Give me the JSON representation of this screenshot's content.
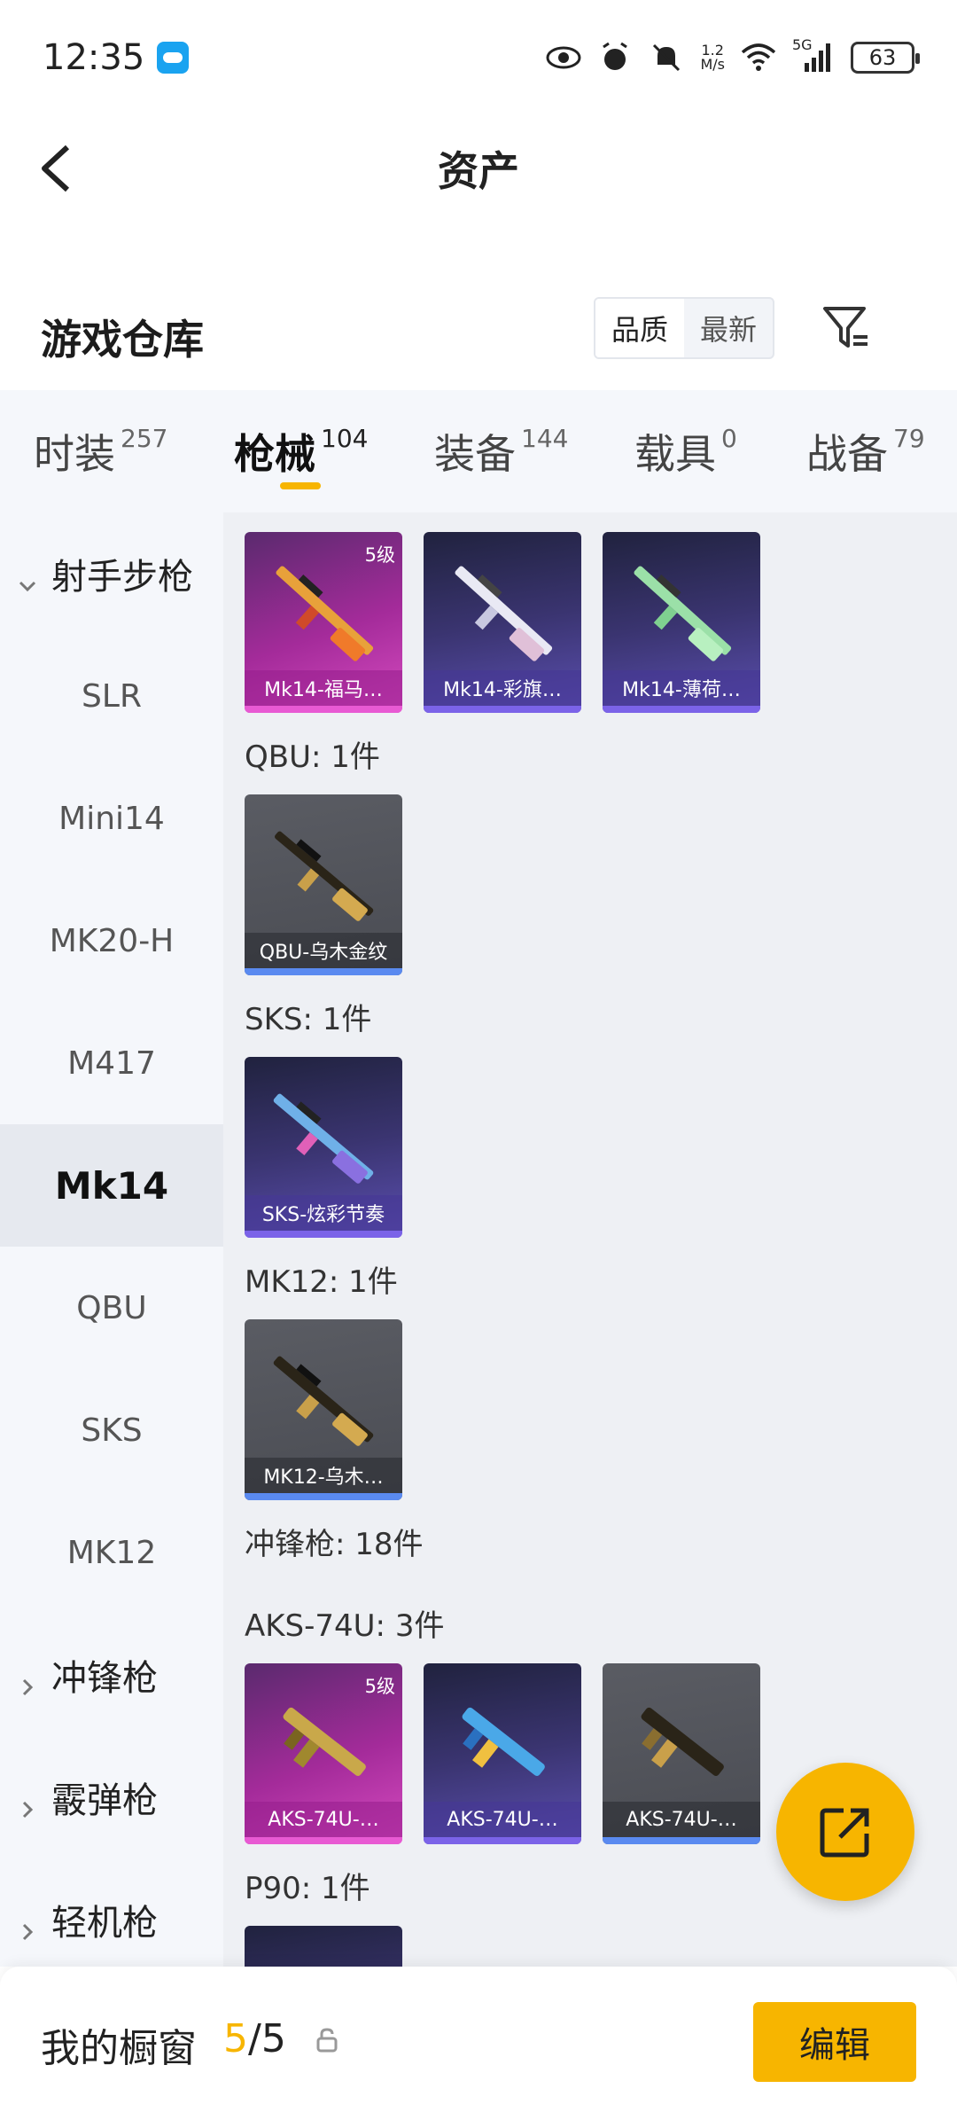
{
  "status_bar": {
    "time": "12:35",
    "net_speed_value": "1.2",
    "net_speed_unit": "M/s",
    "network": "5G",
    "battery": "63"
  },
  "header": {
    "title": "资产"
  },
  "warehouse": {
    "title": "游戏仓库",
    "sort_options": [
      "品质",
      "最新"
    ],
    "selected_sort": "品质"
  },
  "tabs": [
    {
      "label": "时装",
      "count": "257"
    },
    {
      "label": "枪械",
      "count": "104",
      "active": true
    },
    {
      "label": "装备",
      "count": "144"
    },
    {
      "label": "载具",
      "count": "0"
    },
    {
      "label": "战备",
      "count": "79"
    }
  ],
  "sidebar": {
    "items": [
      {
        "label": "射手步枪",
        "type": "group",
        "expanded": true
      },
      {
        "label": "SLR"
      },
      {
        "label": "Mini14"
      },
      {
        "label": "MK20-H"
      },
      {
        "label": "M417"
      },
      {
        "label": "Mk14",
        "active": true
      },
      {
        "label": "QBU"
      },
      {
        "label": "SKS"
      },
      {
        "label": "MK12"
      },
      {
        "label": "冲锋枪",
        "type": "group"
      },
      {
        "label": "霰弹枪",
        "type": "group"
      },
      {
        "label": "轻机枪",
        "type": "group"
      }
    ]
  },
  "content": {
    "mk14_items": [
      {
        "name": "Mk14-福马…",
        "rarity": "pink",
        "level": "5级"
      },
      {
        "name": "Mk14-彩旗…",
        "rarity": "purple"
      },
      {
        "name": "Mk14-薄荷…",
        "rarity": "purple"
      }
    ],
    "qbu": {
      "label": "QBU: 1件",
      "items": [
        {
          "name": "QBU-乌木金纹",
          "rarity": "gray"
        }
      ]
    },
    "sks": {
      "label": "SKS: 1件",
      "items": [
        {
          "name": "SKS-炫彩节奏",
          "rarity": "purple"
        }
      ]
    },
    "mk12": {
      "label": "MK12: 1件",
      "items": [
        {
          "name": "MK12-乌木…",
          "rarity": "gray"
        }
      ]
    },
    "smg_category": "冲锋枪: 18件",
    "aks": {
      "label": "AKS-74U: 3件",
      "items": [
        {
          "name": "AKS-74U-…",
          "rarity": "pink",
          "level": "5级"
        },
        {
          "name": "AKS-74U-…",
          "rarity": "purple"
        },
        {
          "name": "AKS-74U-…",
          "rarity": "gray"
        }
      ]
    },
    "p90": {
      "label": "P90: 1件"
    }
  },
  "bottom_bar": {
    "window_label": "我的橱窗",
    "window_current": "5",
    "window_separator": "/",
    "window_total": "5",
    "edit_label": "编辑"
  },
  "colors": {
    "accent": "#f7b500",
    "rarity_pink": "#d64bc0",
    "rarity_purple": "#5b4fb0",
    "rarity_gray": "#4a4c53"
  },
  "icons": [
    "back-arrow-icon",
    "filter-icon",
    "chevron-down-icon",
    "chevron-right-icon",
    "share-icon",
    "lock-icon",
    "eye-icon",
    "alarm-icon",
    "mute-icon",
    "wifi-icon",
    "signal-icon"
  ]
}
